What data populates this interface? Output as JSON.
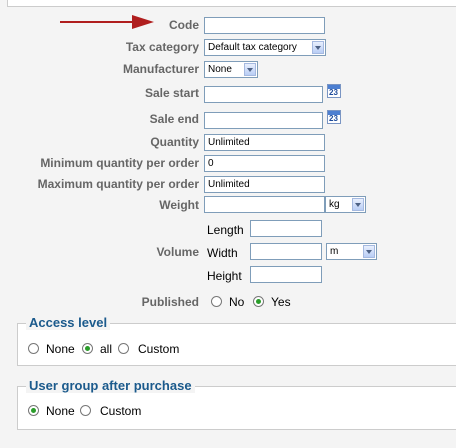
{
  "fields": {
    "code": {
      "label": "Code",
      "value": ""
    },
    "tax_category": {
      "label": "Tax category",
      "value": "Default tax category"
    },
    "manufacturer": {
      "label": "Manufacturer",
      "value": "None"
    },
    "sale_start": {
      "label": "Sale start",
      "value": "",
      "calendar_text": "23"
    },
    "sale_end": {
      "label": "Sale end",
      "value": "",
      "calendar_text": "23"
    },
    "quantity": {
      "label": "Quantity",
      "value": "Unlimited"
    },
    "min_qty": {
      "label": "Minimum quantity per order",
      "value": "0"
    },
    "max_qty": {
      "label": "Maximum quantity per order",
      "value": "Unlimited"
    },
    "weight": {
      "label": "Weight",
      "value": "",
      "unit": "kg"
    },
    "volume": {
      "label": "Volume",
      "length_label": "Length",
      "length_value": "",
      "width_label": "Width",
      "width_value": "",
      "height_label": "Height",
      "height_value": "",
      "unit": "m"
    },
    "published": {
      "label": "Published",
      "options": [
        "No",
        "Yes"
      ],
      "selected": "Yes"
    }
  },
  "access_level": {
    "legend": "Access level",
    "options": [
      "None",
      "all",
      "Custom"
    ],
    "selected": "all"
  },
  "user_group": {
    "legend": "User group after purchase",
    "options": [
      "None",
      "Custom"
    ],
    "selected": "None"
  },
  "annotation": {
    "color": "#b01e1e",
    "icon": "arrow-right-icon"
  }
}
